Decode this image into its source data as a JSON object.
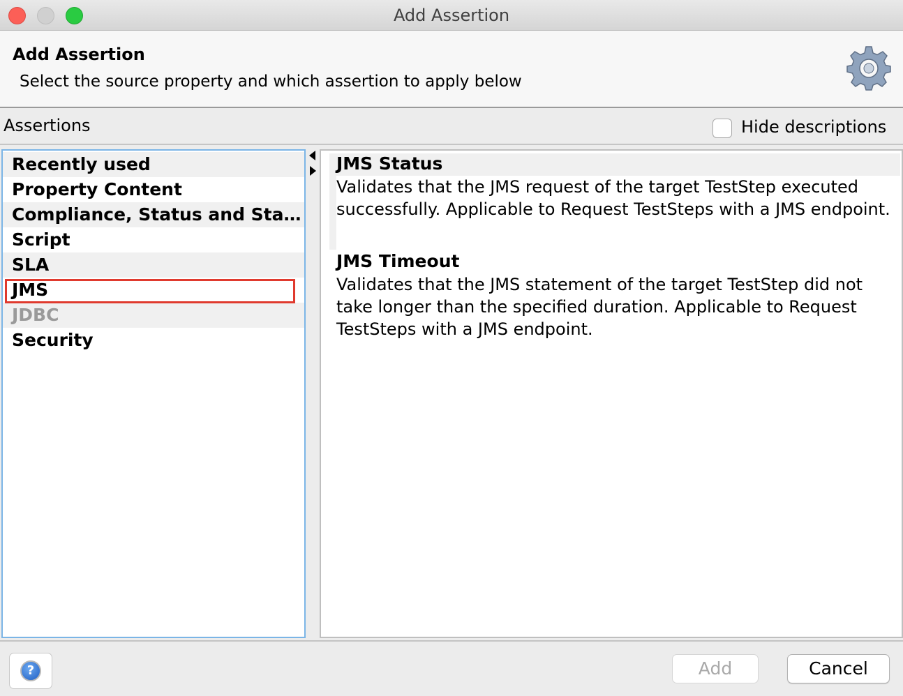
{
  "window": {
    "title": "Add Assertion"
  },
  "header": {
    "title": "Add Assertion",
    "subtitle": "Select the source property and which assertion to apply below",
    "icon": "gear-icon"
  },
  "assertions_label": "Assertions",
  "hide_descriptions": {
    "label": "Hide descriptions",
    "checked": false
  },
  "categories": [
    {
      "label": "Recently used",
      "enabled": true
    },
    {
      "label": "Property Content",
      "enabled": true
    },
    {
      "label": "Compliance, Status and Standards",
      "enabled": true
    },
    {
      "label": "Script",
      "enabled": true
    },
    {
      "label": "SLA",
      "enabled": true
    },
    {
      "label": "JMS",
      "enabled": true,
      "selected": true
    },
    {
      "label": "JDBC",
      "enabled": false
    },
    {
      "label": "Security",
      "enabled": true
    }
  ],
  "assertion_types": [
    {
      "title": "JMS Status",
      "description": "Validates that the JMS request of the target TestStep executed successfully. Applicable to Request TestSteps with a JMS endpoint."
    },
    {
      "title": "JMS Timeout",
      "description": "Validates that the JMS statement of the target TestStep did not take longer than the specified duration. Applicable to Request TestSteps with a JMS endpoint."
    }
  ],
  "buttons": {
    "help_icon": "help-icon",
    "add_label": "Add",
    "cancel_label": "Cancel"
  },
  "colors": {
    "selection_border": "#e03a2e",
    "focus_border": "#7bb5e6"
  }
}
